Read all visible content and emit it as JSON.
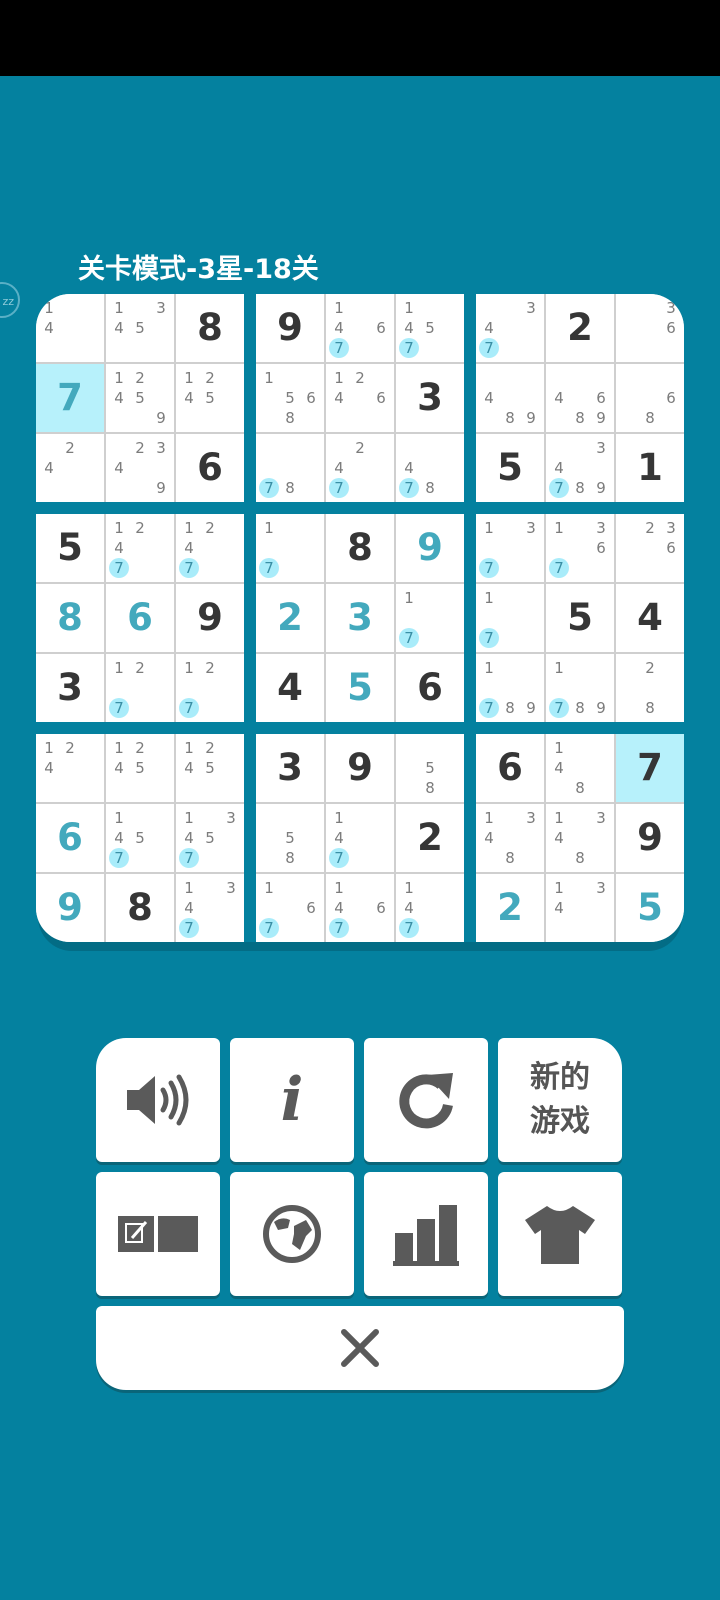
{
  "level_title": "关卡模式-3星-18关",
  "side_badge": "zz",
  "colors": {
    "background": "#04819f",
    "given": "#363636",
    "user": "#43a9bd",
    "highlight": "#b7f1fb",
    "candidate": "#7c7c7c",
    "candidate_mark": "#a9ecfa"
  },
  "grid": [
    [
      {
        "c": "14"
      },
      {
        "c": "1345"
      },
      {
        "v": "8"
      },
      {
        "v": "9"
      },
      {
        "c": "146",
        "m": "7"
      },
      {
        "c": "145",
        "m": "7"
      },
      {
        "c": "34",
        "m": "7"
      },
      {
        "v": "2"
      },
      {
        "c": "36"
      }
    ],
    [
      {
        "v": "7",
        "t": "user",
        "hl": true
      },
      {
        "c": "12459"
      },
      {
        "c": "1245"
      },
      {
        "c": "1568"
      },
      {
        "c": "1246"
      },
      {
        "v": "3"
      },
      {
        "c": "489"
      },
      {
        "c": "4689"
      },
      {
        "c": "68"
      }
    ],
    [
      {
        "c": "24"
      },
      {
        "c": "2349"
      },
      {
        "v": "6"
      },
      {
        "c": "8",
        "m": "7"
      },
      {
        "c": "24",
        "m": "7"
      },
      {
        "c": "48",
        "m": "7"
      },
      {
        "v": "5"
      },
      {
        "c": "3489",
        "m": "7"
      },
      {
        "v": "1"
      }
    ],
    [
      {
        "v": "5"
      },
      {
        "c": "124",
        "m": "7"
      },
      {
        "c": "124",
        "m": "7"
      },
      {
        "c": "1",
        "m": "7"
      },
      {
        "v": "8"
      },
      {
        "v": "9",
        "t": "user"
      },
      {
        "c": "13",
        "m": "7"
      },
      {
        "c": "136",
        "m": "7"
      },
      {
        "c": "236"
      }
    ],
    [
      {
        "v": "8",
        "t": "user"
      },
      {
        "v": "6",
        "t": "user"
      },
      {
        "v": "9"
      },
      {
        "v": "2",
        "t": "user"
      },
      {
        "v": "3",
        "t": "user"
      },
      {
        "c": "1",
        "m": "7"
      },
      {
        "c": "1",
        "m": "7"
      },
      {
        "v": "5"
      },
      {
        "v": "4"
      }
    ],
    [
      {
        "v": "3"
      },
      {
        "c": "12",
        "m": "7"
      },
      {
        "c": "12",
        "m": "7"
      },
      {
        "v": "4"
      },
      {
        "v": "5",
        "t": "user"
      },
      {
        "v": "6"
      },
      {
        "c": "189",
        "m": "7"
      },
      {
        "c": "189",
        "m": "7"
      },
      {
        "c": "28"
      }
    ],
    [
      {
        "c": "124"
      },
      {
        "c": "1245"
      },
      {
        "c": "1245"
      },
      {
        "v": "3"
      },
      {
        "v": "9"
      },
      {
        "c": "58"
      },
      {
        "v": "6"
      },
      {
        "c": "148"
      },
      {
        "v": "7",
        "hl": true
      }
    ],
    [
      {
        "v": "6",
        "t": "user"
      },
      {
        "c": "145",
        "m": "7"
      },
      {
        "c": "1345",
        "m": "7"
      },
      {
        "c": "58"
      },
      {
        "c": "14",
        "m": "7"
      },
      {
        "v": "2"
      },
      {
        "c": "1348"
      },
      {
        "c": "1348"
      },
      {
        "v": "9"
      }
    ],
    [
      {
        "v": "9",
        "t": "user"
      },
      {
        "v": "8"
      },
      {
        "c": "134",
        "m": "7"
      },
      {
        "c": "16",
        "m": "7"
      },
      {
        "c": "146",
        "m": "7"
      },
      {
        "c": "14",
        "m": "7"
      },
      {
        "v": "2",
        "t": "user"
      },
      {
        "c": "134"
      },
      {
        "v": "5",
        "t": "user"
      }
    ]
  ],
  "menu": {
    "new_game_line1": "新的",
    "new_game_line2": "游戏",
    "info_label": "i",
    "buttons": [
      {
        "name": "sound-button",
        "icon": "speaker-icon"
      },
      {
        "name": "info-button",
        "icon": "info-icon"
      },
      {
        "name": "restart-button",
        "icon": "refresh-icon"
      },
      {
        "name": "new-game-button",
        "icon": ""
      },
      {
        "name": "notes-button",
        "icon": "notes-toggle-icon"
      },
      {
        "name": "language-button",
        "icon": "globe-icon"
      },
      {
        "name": "stats-button",
        "icon": "bar-chart-icon"
      },
      {
        "name": "theme-button",
        "icon": "shirt-icon"
      },
      {
        "name": "close-button",
        "icon": "close-icon"
      }
    ]
  }
}
